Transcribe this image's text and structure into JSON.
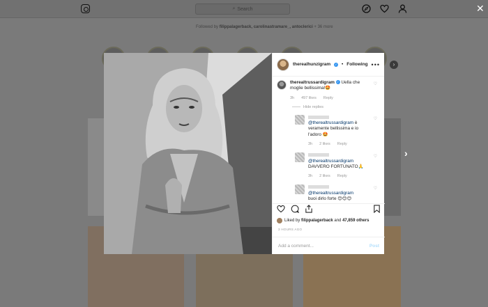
{
  "nav": {
    "search_placeholder": "Search",
    "search_icon": "search-icon",
    "icons": [
      "compass-icon",
      "heart-icon",
      "user-icon"
    ],
    "close": "✕"
  },
  "profile": {
    "followed_by_prefix": "Followed by ",
    "followed_by_names": "filippalagerback, carolinastramare_, antoclerici",
    "followed_by_more": " + 36 more"
  },
  "post": {
    "author": "therealhunzigram",
    "follow_label": "Following",
    "comments": [
      {
        "user": "therealtrussardigram",
        "text": "Uella che moglie bellissima!🤩",
        "time": "3h",
        "likes": "497 likes",
        "reply": "Reply"
      }
    ],
    "hide_replies": "Hide replies",
    "replies": [
      {
        "mention": "@therealtrussardigram",
        "text": " è veramente bellissima e io l'adoro 🤩",
        "time": "3h",
        "likes": "2 likes",
        "reply": "Reply"
      },
      {
        "mention": "@therealtrussardigram",
        "text": " DAVVERO FORTUNATO🙏",
        "time": "3h",
        "likes": "2 likes",
        "reply": "Reply"
      },
      {
        "mention": "@therealtrussardigram",
        "text": " buoi dirlo forte 😊😊😊",
        "time": "",
        "likes": "",
        "reply": ""
      }
    ],
    "liked_by_prefix": "Liked by ",
    "liked_by_user": "filippalagerback",
    "liked_by_and": " and ",
    "liked_by_count": "47,859 others",
    "timestamp": "3 HOURS AGO",
    "add_comment_placeholder": "Add a comment...",
    "post_label": "Post"
  }
}
